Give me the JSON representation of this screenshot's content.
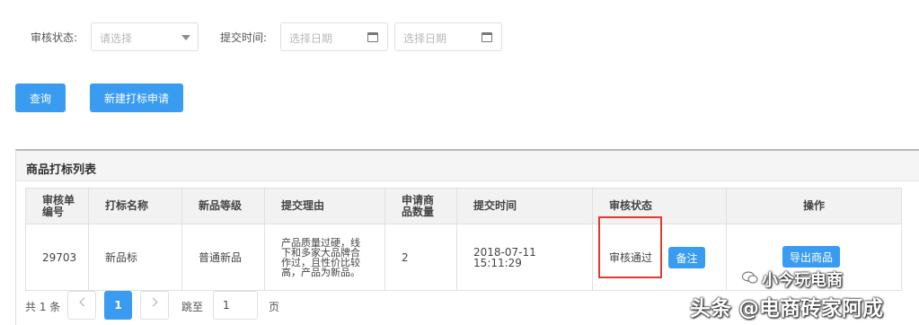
{
  "filters": {
    "status_label": "审核状态:",
    "status_placeholder": "请选择",
    "time_label": "提交时间:",
    "date_start_placeholder": "选择日期",
    "date_end_placeholder": "选择日期"
  },
  "actions": {
    "query_label": "查询",
    "new_label": "新建打标申请"
  },
  "panel": {
    "title": "商品打标列表"
  },
  "table": {
    "headers": [
      "审核单编号",
      "打标名称",
      "新品等级",
      "提交理由",
      "申请商品数量",
      "提交时间",
      "审核状态",
      "操作"
    ],
    "rows": [
      {
        "id": "29703",
        "name": "新品标",
        "level": "普通新品",
        "reason": "产品质量过硬，线下和多家大品牌合作过，且性价比较高，产品为新品。",
        "qty": "2",
        "time": "2018-07-11 15:11:29",
        "status": "审核通过",
        "remark_label": "备注",
        "export_label": "导出商品"
      }
    ]
  },
  "pagination": {
    "total_text": "共 1 条",
    "current_page": "1",
    "jump_label": "跳至",
    "jump_value": "1",
    "page_suffix": "页"
  },
  "watermark": {
    "line1": "小今玩电商",
    "line2": "头条 @电商砖家阿成"
  },
  "colors": {
    "primary": "#3a9cf0",
    "highlight_border": "#e03b30"
  }
}
